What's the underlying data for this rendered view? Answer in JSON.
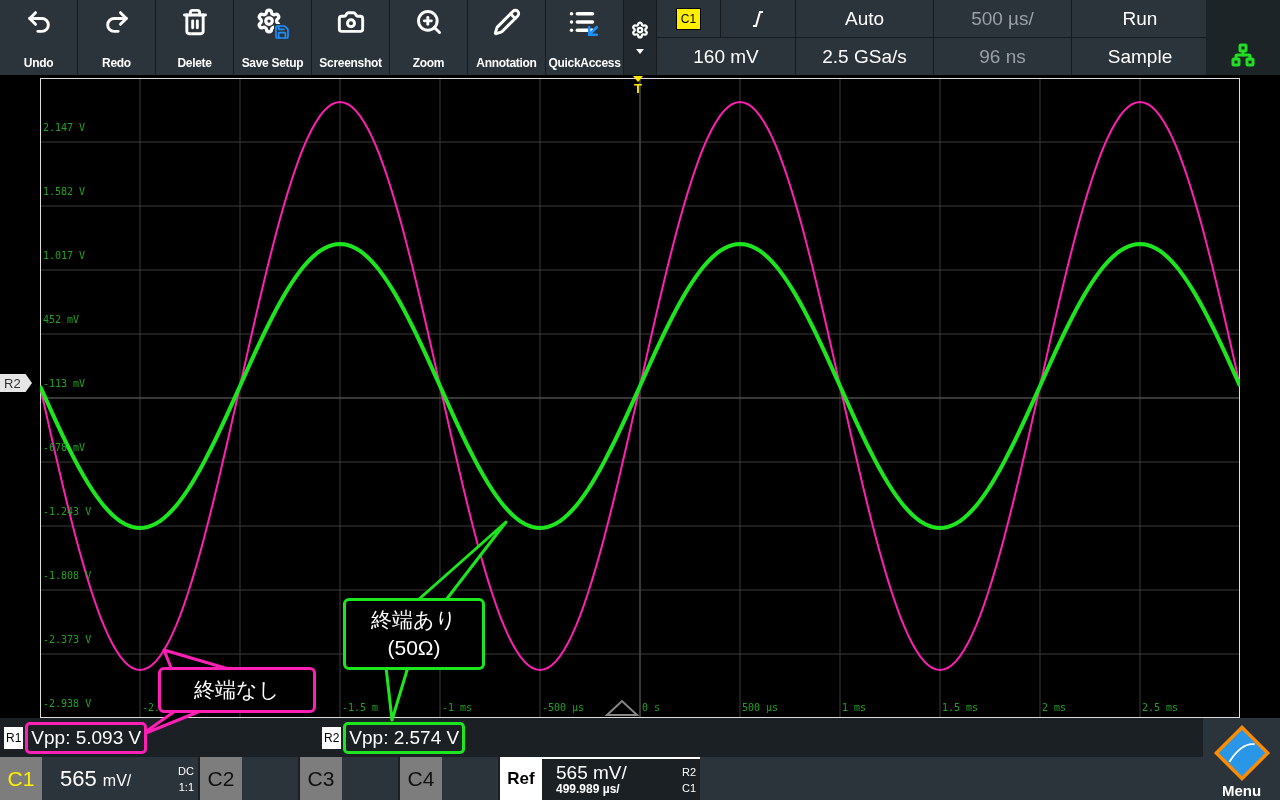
{
  "toolbar": [
    {
      "kind": "undo",
      "label": "Undo"
    },
    {
      "kind": "redo",
      "label": "Redo"
    },
    {
      "kind": "delete",
      "label": "Delete"
    },
    {
      "kind": "save",
      "label": "Save Setup"
    },
    {
      "kind": "camera",
      "label": "Screenshot"
    },
    {
      "kind": "zoom",
      "label": "Zoom"
    },
    {
      "kind": "pencil",
      "label": "Annotation"
    },
    {
      "kind": "quick",
      "label": "QuickAccess"
    }
  ],
  "status": {
    "trigger_source": "C1",
    "row1": [
      {
        "text": "Auto",
        "disabled": false
      },
      {
        "text": "500 µs/",
        "disabled": true
      },
      {
        "text": "Run",
        "disabled": false
      }
    ],
    "row2": [
      {
        "text": "160 mV",
        "disabled": false
      },
      {
        "text": "2.5 GSa/s",
        "disabled": false
      },
      {
        "text": "96 ns",
        "disabled": true
      },
      {
        "text": "Sample",
        "disabled": false
      }
    ]
  },
  "plot": {
    "trigger_marker": "T",
    "ref_marker": "R2",
    "y_labels": [
      "2.147 V",
      "1.582 V",
      "1.017 V",
      "452 mV",
      "-113 mV",
      "-678 mV",
      "-1.243 V",
      "-1.808 V",
      "-2.373 V",
      "-2.938 V"
    ],
    "x_labels": [
      "-2.",
      "-1.5 m",
      "-1 ms",
      "-500 µs",
      "0 s",
      "500 µs",
      "1 ms",
      "1.5 ms",
      "2 ms",
      "2.5 ms"
    ],
    "callouts": [
      {
        "lines": [
          "終端なし"
        ],
        "color": "#ff1fb4"
      },
      {
        "lines": [
          "終端あり",
          "(50Ω)"
        ],
        "color": "#1ee61e"
      }
    ]
  },
  "measurements": [
    {
      "ref": "R1",
      "text": "Vpp: 5.093 V",
      "color": "#ff1fb4"
    },
    {
      "ref": "R2",
      "text": "Vpp: 2.574 V",
      "color": "#1ee61e"
    }
  ],
  "channels": [
    {
      "name": "C1",
      "active": true,
      "scale": "565",
      "unit": "mV/",
      "coupling": "DC",
      "probe": "1:1"
    },
    {
      "name": "C2",
      "active": false
    },
    {
      "name": "C3",
      "active": false
    },
    {
      "name": "C4",
      "active": false
    }
  ],
  "reference": {
    "label": "Ref",
    "scale": "565 mV/",
    "time": "499.989 µs/",
    "source_a": "R2",
    "source_b": "C1"
  },
  "menu": {
    "label": "Menu"
  }
}
